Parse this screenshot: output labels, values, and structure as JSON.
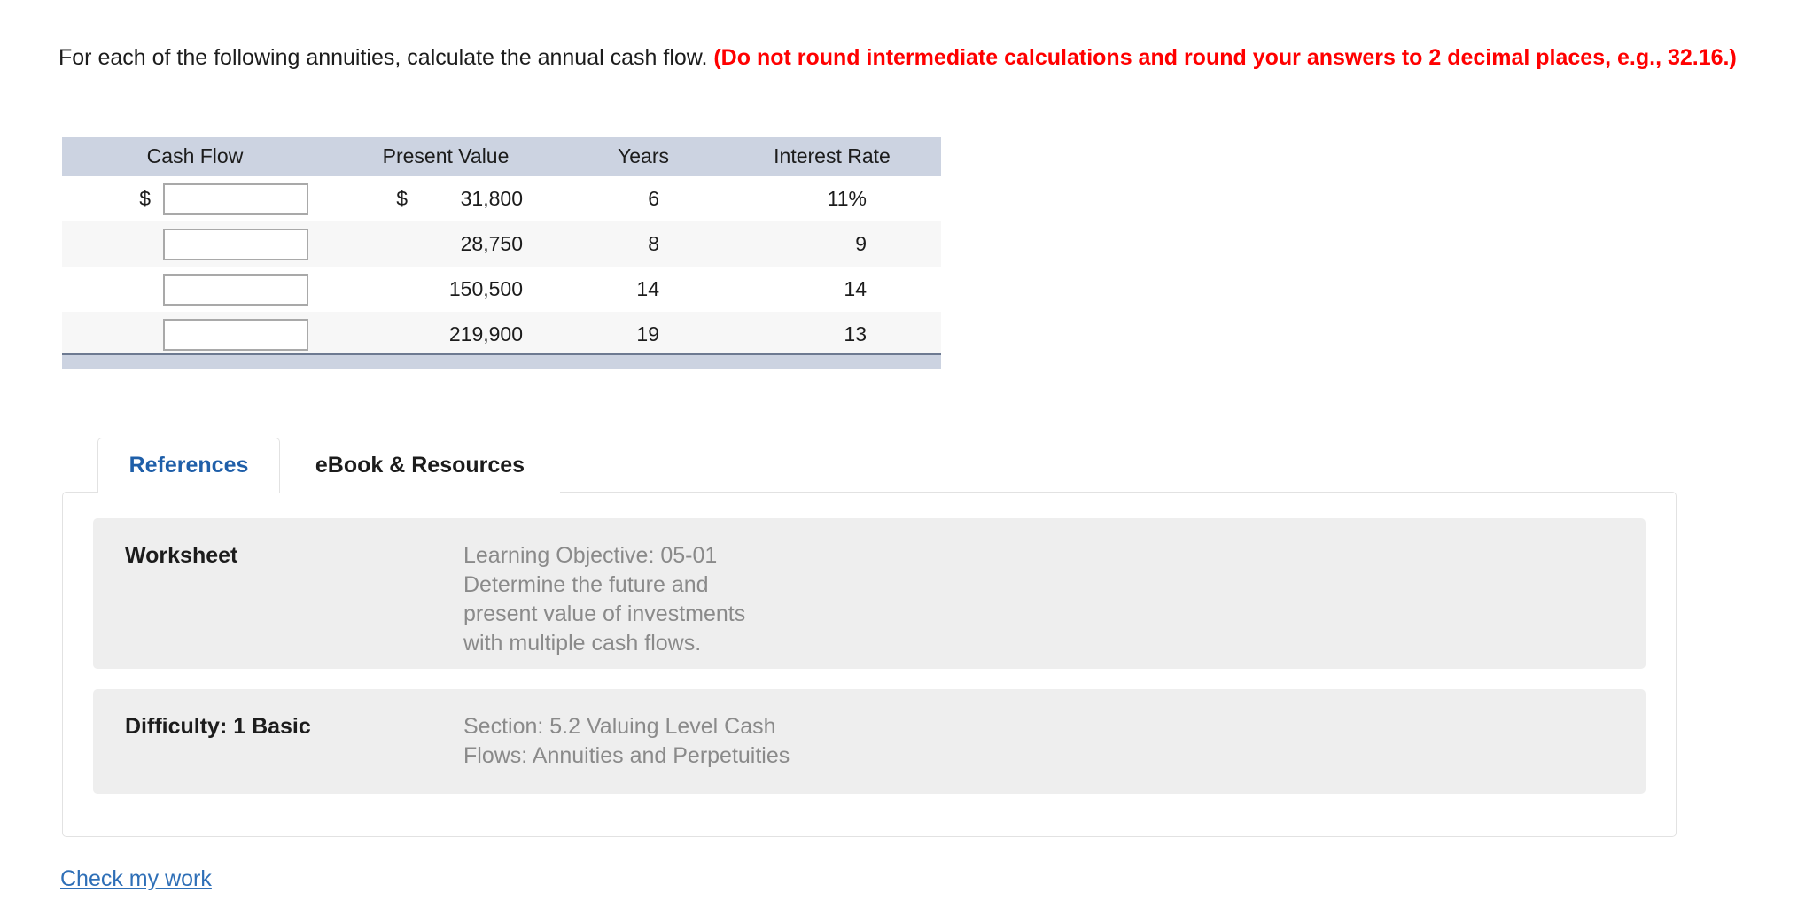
{
  "prompt": {
    "normal_text": "For each of the following annuities, calculate the annual cash flow. ",
    "emphasis_text": "(Do not round intermediate calculations and round your answers to 2 decimal places, e.g., 32.16.)"
  },
  "table": {
    "headers": {
      "cash_flow": "Cash Flow",
      "present_value": "Present Value",
      "years": "Years",
      "interest_rate": "Interest Rate"
    },
    "rows": [
      {
        "cash_flow_symbol": "$",
        "cash_flow_value": "",
        "cash_flow_placeholder": "",
        "pv_symbol": "$",
        "present_value": "31,800",
        "years": "6",
        "interest_rate": "11%"
      },
      {
        "cash_flow_symbol": "$",
        "cash_flow_value": "",
        "cash_flow_placeholder": "",
        "pv_symbol": "$",
        "present_value": "28,750",
        "years": "8",
        "interest_rate": "9"
      },
      {
        "cash_flow_symbol": "$",
        "cash_flow_value": "",
        "cash_flow_placeholder": "",
        "pv_symbol": "$",
        "present_value": "150,500",
        "years": "14",
        "interest_rate": "14"
      },
      {
        "cash_flow_symbol": "$",
        "cash_flow_value": "",
        "cash_flow_placeholder": "",
        "pv_symbol": "$",
        "present_value": "219,900",
        "years": "19",
        "interest_rate": "13"
      }
    ]
  },
  "tabs": [
    {
      "label": "References",
      "active": true
    },
    {
      "label": "eBook & Resources",
      "active": false
    }
  ],
  "panel": {
    "worksheet": {
      "label": "Worksheet",
      "text": "Learning Objective: 05-01\nDetermine the future and\npresent value of investments\nwith multiple cash flows."
    },
    "difficulty": {
      "label": "Difficulty: 1 Basic",
      "text": "Section: 5.2 Valuing Level Cash\nFlows: Annuities and Perpetuities"
    }
  },
  "footer": {
    "check_my_work": "Check my work"
  },
  "colors": {
    "emphasis_red": "#ff0000",
    "table_header_bg": "#ccd3e1",
    "table_footer_border": "#6d7a91",
    "row_alt_bg": "#f7f7f7",
    "active_tab_text": "#1f5fa9",
    "panel_block_bg": "#eeeeee",
    "panel_text_gray": "#8a8a8a",
    "link_blue": "#2e6fb7"
  }
}
